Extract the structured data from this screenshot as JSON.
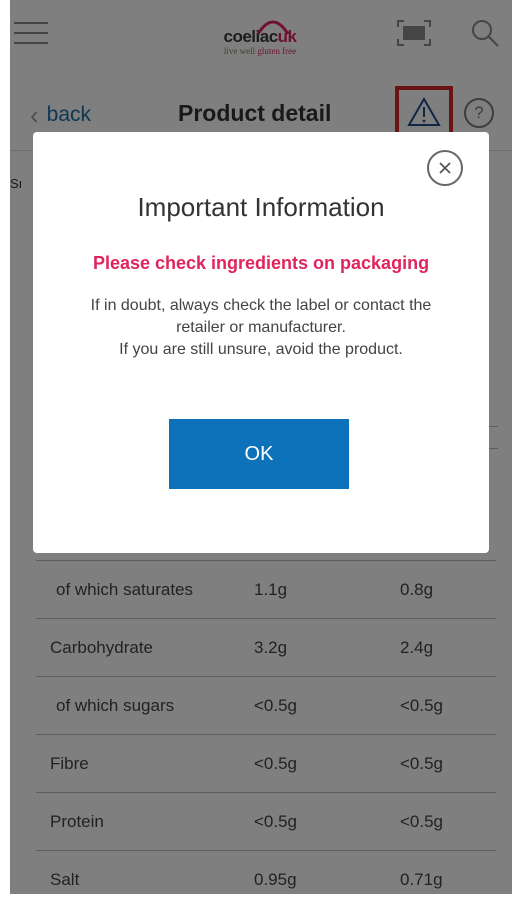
{
  "header": {
    "logo_text_main": "coeliac",
    "logo_text_uk": "uk",
    "logo_tagline_prefix": "live well",
    "logo_tagline_highlight": "gluten free",
    "menu_icon": "hamburger-menu-icon",
    "barcode_icon": "barcode-scan-icon",
    "search_icon": "search-icon"
  },
  "nav": {
    "back_label": "back",
    "title": "Product detail",
    "warning_icon": "warning-triangle-icon",
    "help_label": "?"
  },
  "background": {
    "peek_left": "Sı",
    "peek_right": ":"
  },
  "nutrition": {
    "rows": [
      {
        "name": "of which saturates",
        "col1": "1.1g",
        "col2": "0.8g"
      },
      {
        "name": "Carbohydrate",
        "col1": "3.2g",
        "col2": "2.4g"
      },
      {
        "name": "of which sugars",
        "col1": "<0.5g",
        "col2": "<0.5g"
      },
      {
        "name": "Fibre",
        "col1": "<0.5g",
        "col2": "<0.5g"
      },
      {
        "name": "Protein",
        "col1": "<0.5g",
        "col2": "<0.5g"
      },
      {
        "name": "Salt",
        "col1": "0.95g",
        "col2": "0.71g"
      }
    ]
  },
  "modal": {
    "title": "Important Information",
    "subtitle": "Please check ingredients on packaging",
    "body_lines": [
      "If in doubt, always check the label or contact the",
      "retailer or manufacturer.",
      "If you are still unsure, avoid the product."
    ],
    "ok_label": "OK",
    "close_icon": "close-icon"
  },
  "colors": {
    "accent_pink": "#e0245e",
    "primary_blue": "#0d72b9",
    "link_blue": "#1f6fa8",
    "highlight_red": "#d9262c"
  }
}
